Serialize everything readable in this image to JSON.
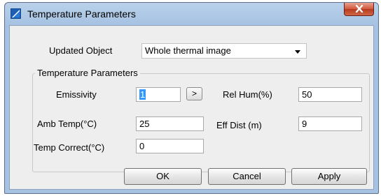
{
  "window": {
    "title": "Temperature Parameters",
    "icon": "thermal-app-icon",
    "close_icon": "close-icon"
  },
  "updated_object": {
    "label": "Updated Object",
    "value": "Whole thermal image"
  },
  "group": {
    "title": "Temperature Parameters"
  },
  "fields": {
    "emissivity": {
      "label": "Emissivity",
      "value": "1"
    },
    "emissivity_button": ">",
    "rel_hum": {
      "label": "Rel  Hum(%)",
      "value": "50"
    },
    "amb_temp": {
      "label": "Amb Temp(°C)",
      "value": "25"
    },
    "eff_dist": {
      "label": "Eff Dist (m)",
      "value": "9"
    },
    "temp_correct": {
      "label": "Temp Correct(°C)",
      "value": "0"
    }
  },
  "buttons": {
    "ok": "OK",
    "cancel": "Cancel",
    "apply": "Apply"
  }
}
